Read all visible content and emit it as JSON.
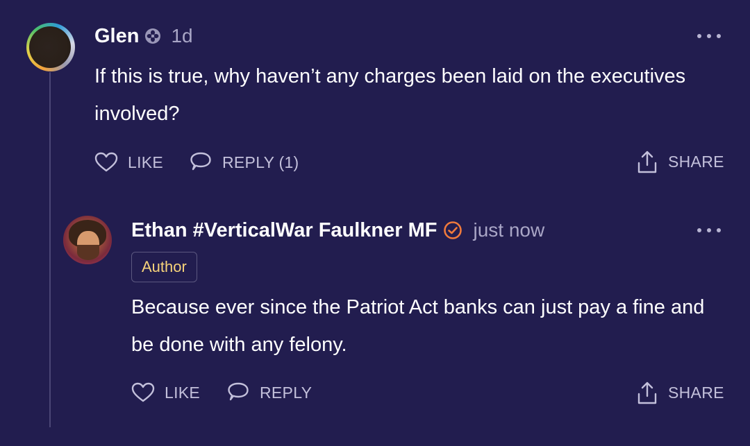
{
  "comments": [
    {
      "author": "Glen",
      "author_icon": "moderator-badge-icon",
      "time": "1d",
      "body": "If this is true, why haven’t any charges been laid on the executives involved?",
      "actions": {
        "like": "LIKE",
        "reply": "REPLY (1)",
        "share": "SHARE"
      }
    },
    {
      "author": "Ethan #VerticalWar Faulkner MF",
      "author_icon": "verified-check-icon",
      "time": "just now",
      "badge": "Author",
      "body": "Because ever since the Patriot Act banks can just pay a fine and be done with any felony.",
      "actions": {
        "like": "LIKE",
        "reply": "REPLY",
        "share": "SHARE"
      }
    }
  ],
  "colors": {
    "background": "#221d4f",
    "text": "#ffffff",
    "muted": "#a9a6c6",
    "badge_text": "#f6d27a",
    "verified": "#f07a3c"
  }
}
